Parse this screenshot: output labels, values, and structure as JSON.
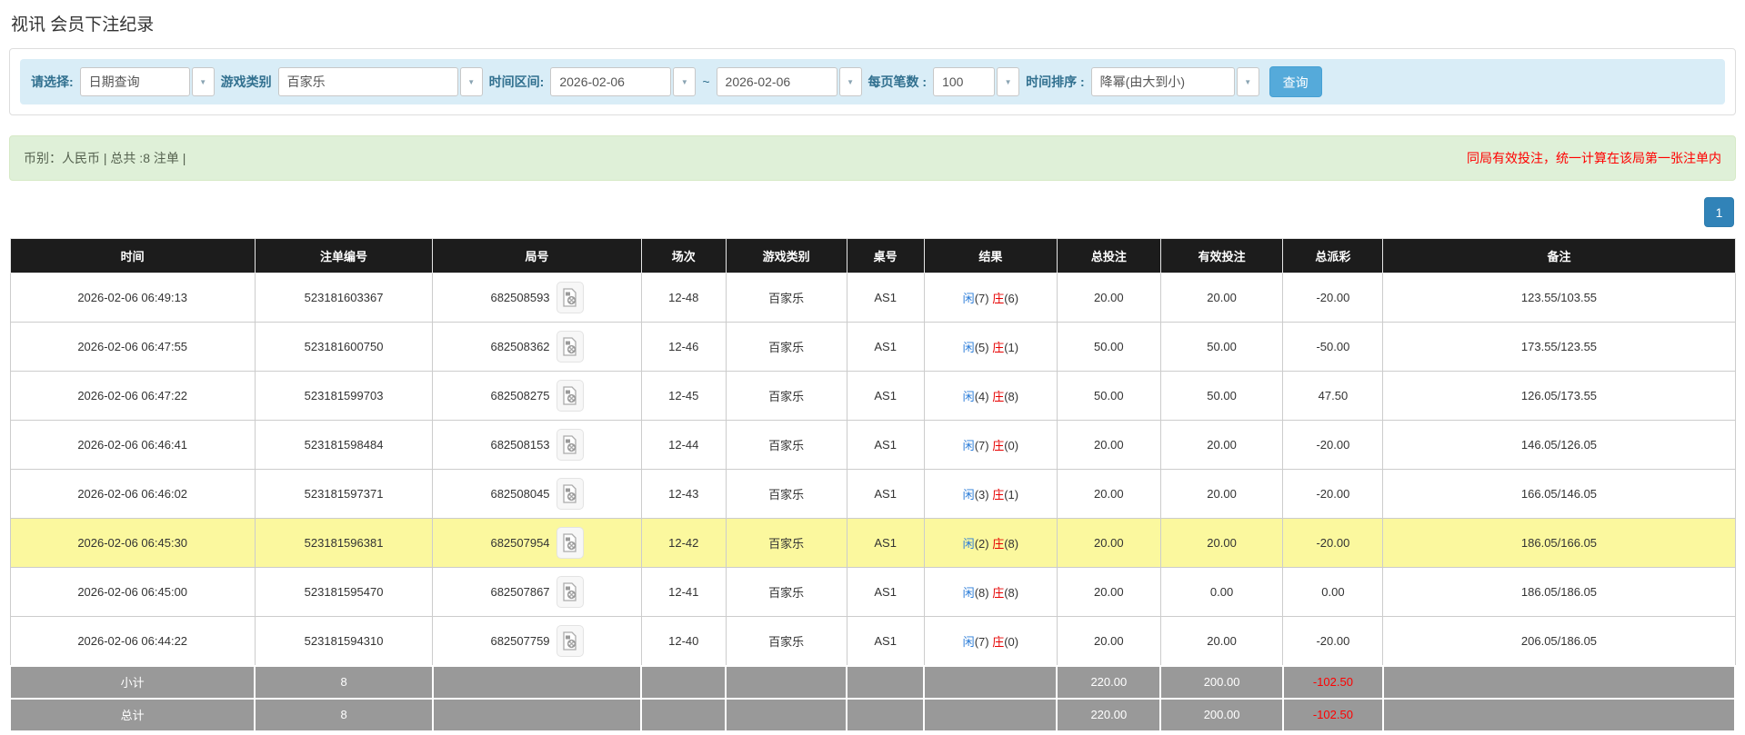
{
  "page": {
    "title": "视讯 会员下注纪录"
  },
  "filters": {
    "select_label": "请选择:",
    "query_type_value": "日期查询",
    "game_type_label": "游戏类别",
    "game_type_value": "百家乐",
    "time_range_label": "时间区间:",
    "date_from": "2026-02-06",
    "range_separator": "~",
    "date_to": "2026-02-06",
    "page_size_label": "每页笔数 :",
    "page_size_value": "100",
    "sort_label": "时间排序 :",
    "sort_value": "降幂(由大到小)",
    "search_button": "查询",
    "combo_arrow_glyph": "▼"
  },
  "info_bar": {
    "left": "币别：人民币 | 总共 :8 注单 |",
    "right": "同局有效投注，统一计算在该局第一张注单内"
  },
  "pagination": {
    "current_page": "1"
  },
  "colors": {
    "header_bg": "#1c1c1c",
    "highlight_row": "#fbf89e",
    "player_blue": "#2a7cd8",
    "banker_red": "#e60000",
    "negative_red": "#ff0000",
    "filter_bar_bg": "#d9edf7",
    "info_bar_bg": "#dff0d8",
    "search_button_bg": "#55aada",
    "pagination_bg": "#3183b8",
    "summary_row_bg": "#999999"
  },
  "table": {
    "columns": [
      "时间",
      "注单编号",
      "局号",
      "场次",
      "游戏类别",
      "桌号",
      "结果",
      "总投注",
      "有效投注",
      "总派彩",
      "备注"
    ],
    "rows": [
      {
        "time": "2026-02-06 06:49:13",
        "order_no": "523181603367",
        "round_no": "682508593",
        "session": "12-48",
        "game": "百家乐",
        "table_no": "AS1",
        "player": "闲",
        "player_score": "(7)",
        "banker": "庄",
        "banker_score": "(6)",
        "total_bet": "20.00",
        "valid_bet": "20.00",
        "payout": "-20.00",
        "remark": "123.55/103.55",
        "highlight": false
      },
      {
        "time": "2026-02-06 06:47:55",
        "order_no": "523181600750",
        "round_no": "682508362",
        "session": "12-46",
        "game": "百家乐",
        "table_no": "AS1",
        "player": "闲",
        "player_score": "(5)",
        "banker": "庄",
        "banker_score": "(1)",
        "total_bet": "50.00",
        "valid_bet": "50.00",
        "payout": "-50.00",
        "remark": "173.55/123.55",
        "highlight": false
      },
      {
        "time": "2026-02-06 06:47:22",
        "order_no": "523181599703",
        "round_no": "682508275",
        "session": "12-45",
        "game": "百家乐",
        "table_no": "AS1",
        "player": "闲",
        "player_score": "(4)",
        "banker": "庄",
        "banker_score": "(8)",
        "total_bet": "50.00",
        "valid_bet": "50.00",
        "payout": "47.50",
        "remark": "126.05/173.55",
        "highlight": false
      },
      {
        "time": "2026-02-06 06:46:41",
        "order_no": "523181598484",
        "round_no": "682508153",
        "session": "12-44",
        "game": "百家乐",
        "table_no": "AS1",
        "player": "闲",
        "player_score": "(7)",
        "banker": "庄",
        "banker_score": "(0)",
        "total_bet": "20.00",
        "valid_bet": "20.00",
        "payout": "-20.00",
        "remark": "146.05/126.05",
        "highlight": false
      },
      {
        "time": "2026-02-06 06:46:02",
        "order_no": "523181597371",
        "round_no": "682508045",
        "session": "12-43",
        "game": "百家乐",
        "table_no": "AS1",
        "player": "闲",
        "player_score": "(3)",
        "banker": "庄",
        "banker_score": "(1)",
        "total_bet": "20.00",
        "valid_bet": "20.00",
        "payout": "-20.00",
        "remark": "166.05/146.05",
        "highlight": false
      },
      {
        "time": "2026-02-06 06:45:30",
        "order_no": "523181596381",
        "round_no": "682507954",
        "session": "12-42",
        "game": "百家乐",
        "table_no": "AS1",
        "player": "闲",
        "player_score": "(2)",
        "banker": "庄",
        "banker_score": "(8)",
        "total_bet": "20.00",
        "valid_bet": "20.00",
        "payout": "-20.00",
        "remark": "186.05/166.05",
        "highlight": true
      },
      {
        "time": "2026-02-06 06:45:00",
        "order_no": "523181595470",
        "round_no": "682507867",
        "session": "12-41",
        "game": "百家乐",
        "table_no": "AS1",
        "player": "闲",
        "player_score": "(8)",
        "banker": "庄",
        "banker_score": "(8)",
        "total_bet": "20.00",
        "valid_bet": "0.00",
        "payout": "0.00",
        "remark": "186.05/186.05",
        "highlight": false
      },
      {
        "time": "2026-02-06 06:44:22",
        "order_no": "523181594310",
        "round_no": "682507759",
        "session": "12-40",
        "game": "百家乐",
        "table_no": "AS1",
        "player": "闲",
        "player_score": "(7)",
        "banker": "庄",
        "banker_score": "(0)",
        "total_bet": "20.00",
        "valid_bet": "20.00",
        "payout": "-20.00",
        "remark": "206.05/186.05",
        "highlight": false
      }
    ],
    "summary": [
      {
        "label": "小计",
        "count": "8",
        "total_bet": "220.00",
        "valid_bet": "200.00",
        "payout": "-102.50"
      },
      {
        "label": "总计",
        "count": "8",
        "total_bet": "220.00",
        "valid_bet": "200.00",
        "payout": "-102.50"
      }
    ]
  }
}
